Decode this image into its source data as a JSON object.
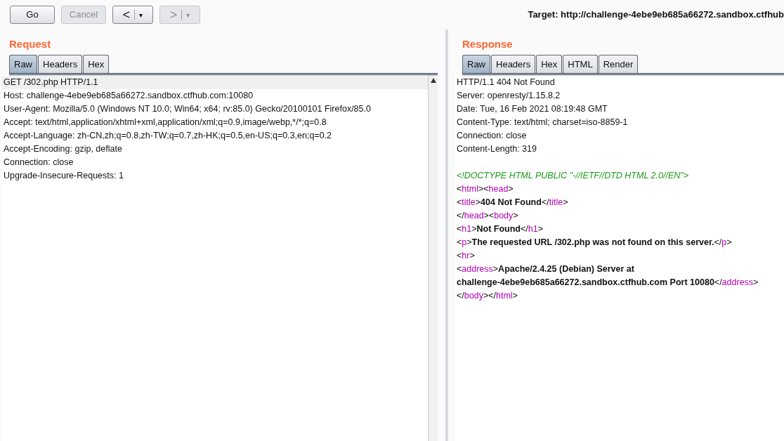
{
  "toolbar": {
    "buttons": [
      {
        "kind": "text",
        "label": "Go",
        "disabled": false
      },
      {
        "kind": "text",
        "label": "Cancel",
        "disabled": true
      },
      {
        "kind": "nav",
        "label": "<",
        "caret": "▾",
        "disabled": false
      },
      {
        "kind": "nav",
        "label": ">",
        "caret": "▾",
        "disabled": true
      }
    ],
    "target": "Target: http://challenge-4ebe9eb685a66272.sandbox.ctfhub"
  },
  "request": {
    "title": "Request",
    "tabs": [
      {
        "label": "Raw",
        "selected": true
      },
      {
        "label": "Headers",
        "selected": false
      },
      {
        "label": "Hex",
        "selected": false
      }
    ],
    "lines": [
      {
        "text": "GET /302.php HTTP/1.1",
        "current": true
      },
      {
        "text": "Host: challenge-4ebe9eb685a66272.sandbox.ctfhub.com:10080",
        "current": false
      },
      {
        "text": "User-Agent: Mozilla/5.0 (Windows NT 10.0; Win64; x64; rv:85.0) Gecko/20100101 Firefox/85.0",
        "current": false
      },
      {
        "text": "Accept: text/html,application/xhtml+xml,application/xml;q=0.9,image/webp,*/*;q=0.8",
        "current": false
      },
      {
        "text": "Accept-Language: zh-CN,zh;q=0.8,zh-TW;q=0.7,zh-HK;q=0.5,en-US;q=0.3,en;q=0.2",
        "current": false
      },
      {
        "text": "Accept-Encoding: gzip, deflate",
        "current": false
      },
      {
        "text": "Connection: close",
        "current": false
      },
      {
        "text": "Upgrade-Insecure-Requests: 1",
        "current": false
      }
    ]
  },
  "response": {
    "title": "Response",
    "tabs": [
      {
        "label": "Raw",
        "selected": true
      },
      {
        "label": "Headers",
        "selected": false
      },
      {
        "label": "Hex",
        "selected": false
      },
      {
        "label": "HTML",
        "selected": false
      },
      {
        "label": "Render",
        "selected": false
      }
    ],
    "lines": [
      [
        {
          "kind": "plain",
          "text": "HTTP/1.1 404 Not Found"
        }
      ],
      [
        {
          "kind": "plain",
          "text": "Server: openresty/1.15.8.2"
        }
      ],
      [
        {
          "kind": "plain",
          "text": "Date: Tue, 16 Feb 2021 08:19:48 GMT"
        }
      ],
      [
        {
          "kind": "plain",
          "text": "Content-Type: text/html; charset=iso-8859-1"
        }
      ],
      [
        {
          "kind": "plain",
          "text": "Connection: close"
        }
      ],
      [
        {
          "kind": "plain",
          "text": "Content-Length: 319"
        }
      ],
      [
        {
          "kind": "blank"
        }
      ],
      [
        {
          "kind": "doctype",
          "text": "<!DOCTYPE HTML PUBLIC \"-//IETF//DTD HTML 2.0//EN\">"
        }
      ],
      [
        {
          "kind": "plain",
          "text": "<"
        },
        {
          "kind": "tag",
          "text": "html"
        },
        {
          "kind": "plain",
          "text": "><"
        },
        {
          "kind": "tag",
          "text": "head"
        },
        {
          "kind": "plain",
          "text": ">"
        }
      ],
      [
        {
          "kind": "plain",
          "text": "<"
        },
        {
          "kind": "tag",
          "text": "title"
        },
        {
          "kind": "plain",
          "text": ">"
        },
        {
          "kind": "content",
          "text": "404 Not Found"
        },
        {
          "kind": "plain",
          "text": "</"
        },
        {
          "kind": "tag",
          "text": "title"
        },
        {
          "kind": "plain",
          "text": ">"
        }
      ],
      [
        {
          "kind": "plain",
          "text": "</"
        },
        {
          "kind": "tag",
          "text": "head"
        },
        {
          "kind": "plain",
          "text": "><"
        },
        {
          "kind": "tag",
          "text": "body"
        },
        {
          "kind": "plain",
          "text": ">"
        }
      ],
      [
        {
          "kind": "plain",
          "text": "<"
        },
        {
          "kind": "tag",
          "text": "h1"
        },
        {
          "kind": "plain",
          "text": ">"
        },
        {
          "kind": "content",
          "text": "Not Found"
        },
        {
          "kind": "plain",
          "text": "</"
        },
        {
          "kind": "tag",
          "text": "h1"
        },
        {
          "kind": "plain",
          "text": ">"
        }
      ],
      [
        {
          "kind": "plain",
          "text": "<"
        },
        {
          "kind": "tag",
          "text": "p"
        },
        {
          "kind": "plain",
          "text": ">"
        },
        {
          "kind": "content",
          "text": "The requested URL /302.php was not found on this server."
        },
        {
          "kind": "plain",
          "text": "</"
        },
        {
          "kind": "tag",
          "text": "p"
        },
        {
          "kind": "plain",
          "text": ">"
        }
      ],
      [
        {
          "kind": "plain",
          "text": "<"
        },
        {
          "kind": "tag",
          "text": "hr"
        },
        {
          "kind": "plain",
          "text": ">"
        }
      ],
      [
        {
          "kind": "plain",
          "text": "<"
        },
        {
          "kind": "tag",
          "text": "address"
        },
        {
          "kind": "plain",
          "text": ">"
        },
        {
          "kind": "content",
          "text": "Apache/2.4.25 (Debian) Server at"
        }
      ],
      [
        {
          "kind": "content",
          "text": "challenge-4ebe9eb685a66272.sandbox.ctfhub.com Port 10080"
        },
        {
          "kind": "plain",
          "text": "</"
        },
        {
          "kind": "tag",
          "text": "address"
        },
        {
          "kind": "plain",
          "text": ">"
        }
      ],
      [
        {
          "kind": "plain",
          "text": "</"
        },
        {
          "kind": "tag",
          "text": "body"
        },
        {
          "kind": "plain",
          "text": "></"
        },
        {
          "kind": "tag",
          "text": "html"
        },
        {
          "kind": "plain",
          "text": ">"
        }
      ]
    ]
  }
}
